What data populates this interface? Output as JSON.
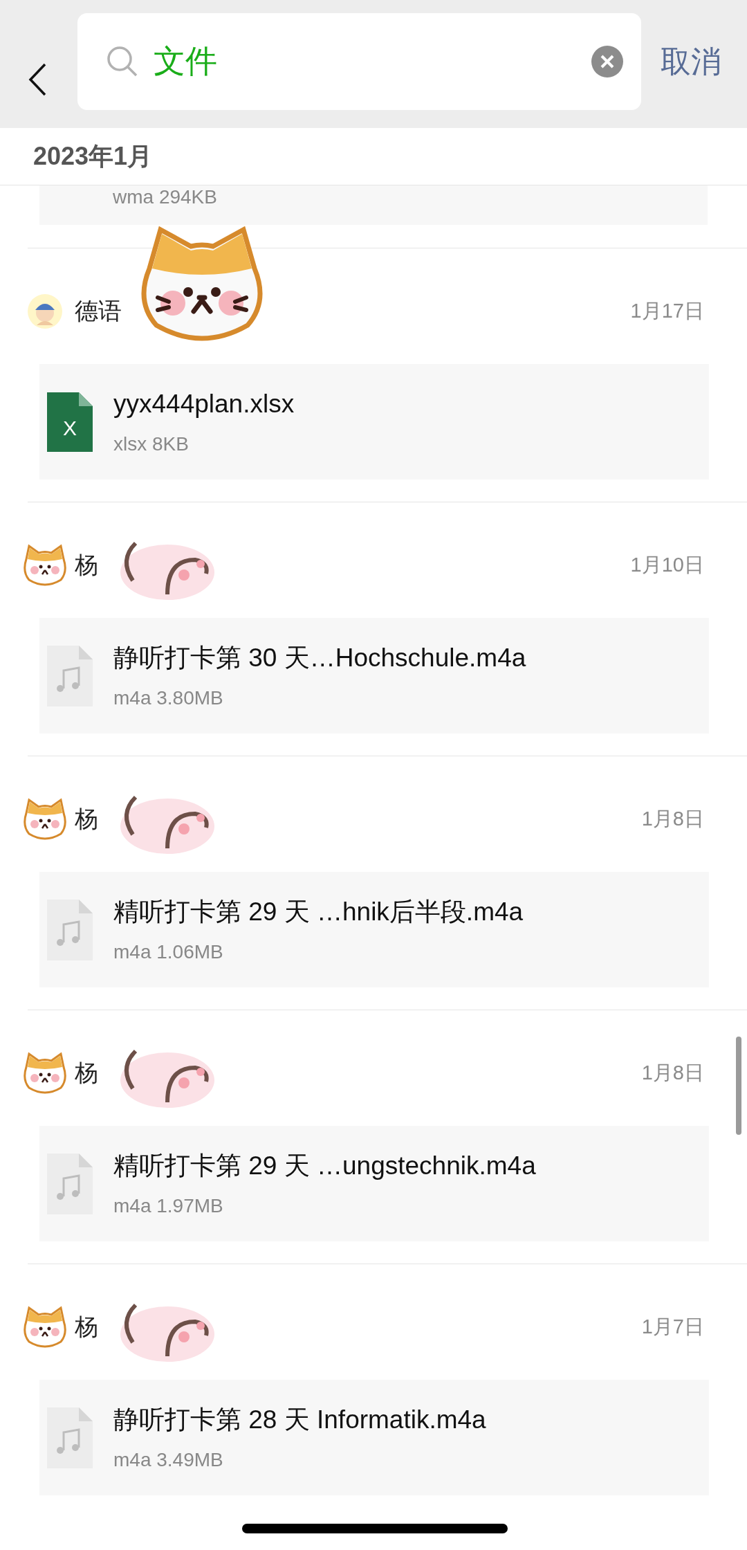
{
  "search": {
    "value": "文件",
    "cancel": "取消"
  },
  "section": {
    "title": "2023年1月"
  },
  "partial_file": {
    "meta": "wma 294KB"
  },
  "entries": [
    {
      "avatar": {
        "kind": "person"
      },
      "sender": "德语",
      "cover": {
        "kind": "cat"
      },
      "date": "1月17日",
      "file": {
        "kind": "xlsx",
        "icon_label": "X",
        "name": "yyx444plan.xlsx",
        "meta": "xlsx 8KB"
      }
    },
    {
      "avatar": {
        "kind": "cat"
      },
      "sender": "杨",
      "cover": {
        "kind": "smudge"
      },
      "date": "1月10日",
      "file": {
        "kind": "audio",
        "name": "静听打卡第 30 天…Hochschule.m4a",
        "meta": "m4a 3.80MB"
      }
    },
    {
      "avatar": {
        "kind": "cat"
      },
      "sender": "杨",
      "cover": {
        "kind": "smudge"
      },
      "date": "1月8日",
      "file": {
        "kind": "audio",
        "name": "精听打卡第 29 天 …hnik后半段.m4a",
        "meta": "m4a 1.06MB"
      }
    },
    {
      "avatar": {
        "kind": "cat"
      },
      "sender": "杨",
      "cover": {
        "kind": "smudge"
      },
      "date": "1月8日",
      "file": {
        "kind": "audio",
        "name": "精听打卡第 29 天 …ungstechnik.m4a",
        "meta": "m4a 1.97MB"
      }
    },
    {
      "avatar": {
        "kind": "cat"
      },
      "sender": "杨",
      "cover": {
        "kind": "smudge"
      },
      "date": "1月7日",
      "file": {
        "kind": "audio",
        "name": "静听打卡第 28 天 Informatik.m4a",
        "meta": "m4a 3.49MB"
      }
    }
  ]
}
